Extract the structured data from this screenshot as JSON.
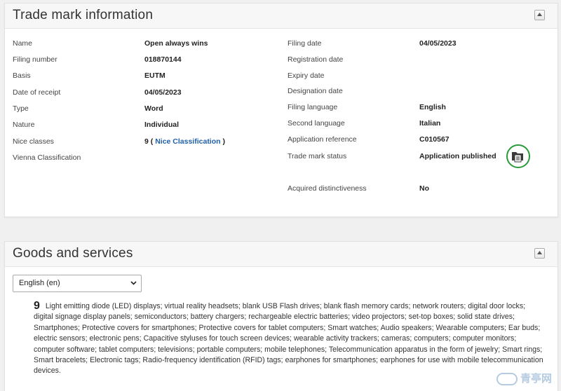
{
  "trademark_panel": {
    "title": "Trade mark information",
    "left": [
      {
        "label": "Name",
        "value": "Open always wins"
      },
      {
        "label": "Filing number",
        "value": "018870144"
      },
      {
        "label": "Basis",
        "value": "EUTM"
      },
      {
        "label": "Date of receipt",
        "value": "04/05/2023"
      },
      {
        "label": "Type",
        "value": "Word"
      },
      {
        "label": "Nature",
        "value": "Individual"
      },
      {
        "label": "Nice classes",
        "value_prefix": "9 (",
        "link": "Nice Classification",
        "value_suffix": ")"
      },
      {
        "label": "Vienna Classification",
        "value": ""
      }
    ],
    "right": [
      {
        "label": "Filing date",
        "value": "04/05/2023"
      },
      {
        "label": "Registration date",
        "value": ""
      },
      {
        "label": "Expiry date",
        "value": ""
      },
      {
        "label": "Designation date",
        "value": ""
      },
      {
        "label": "Filing language",
        "value": "English"
      },
      {
        "label": "Second language",
        "value": "Italian"
      },
      {
        "label": "Application reference",
        "value": "C010567"
      },
      {
        "label": "Trade mark status",
        "value": "Application published"
      },
      {
        "label": "Acquired distinctiveness",
        "value": "No"
      }
    ],
    "status_icon": "folder-document-icon",
    "status_color": "#2a9a3b"
  },
  "goods_panel": {
    "title": "Goods and services",
    "language_select": "English (en)",
    "class_number": "9",
    "description": "Light emitting diode (LED) displays; virtual reality headsets; blank USB Flash drives; blank flash memory cards; network routers; digital door locks; digital signage display panels; semiconductors; battery chargers; rechargeable electric batteries; video projectors; set-top boxes; solid state drives; Smartphones; Protective covers for smartphones; Protective covers for tablet computers; Smart watches; Audio speakers; Wearable computers; Ear buds; electric sensors; electronic pens; Capacitive styluses for touch screen devices; wearable activity trackers; cameras; computers; computer monitors; computer software; tablet computers; televisions; portable computers; mobile telephones; Telecommunication apparatus in the form of jewelry; Smart rings; Smart bracelets; Electronic tags; Radio-frequency identification (RFID) tags; earphones for smartphones; earphones for use with mobile telecommunication devices."
  },
  "watermark": "青亭网"
}
